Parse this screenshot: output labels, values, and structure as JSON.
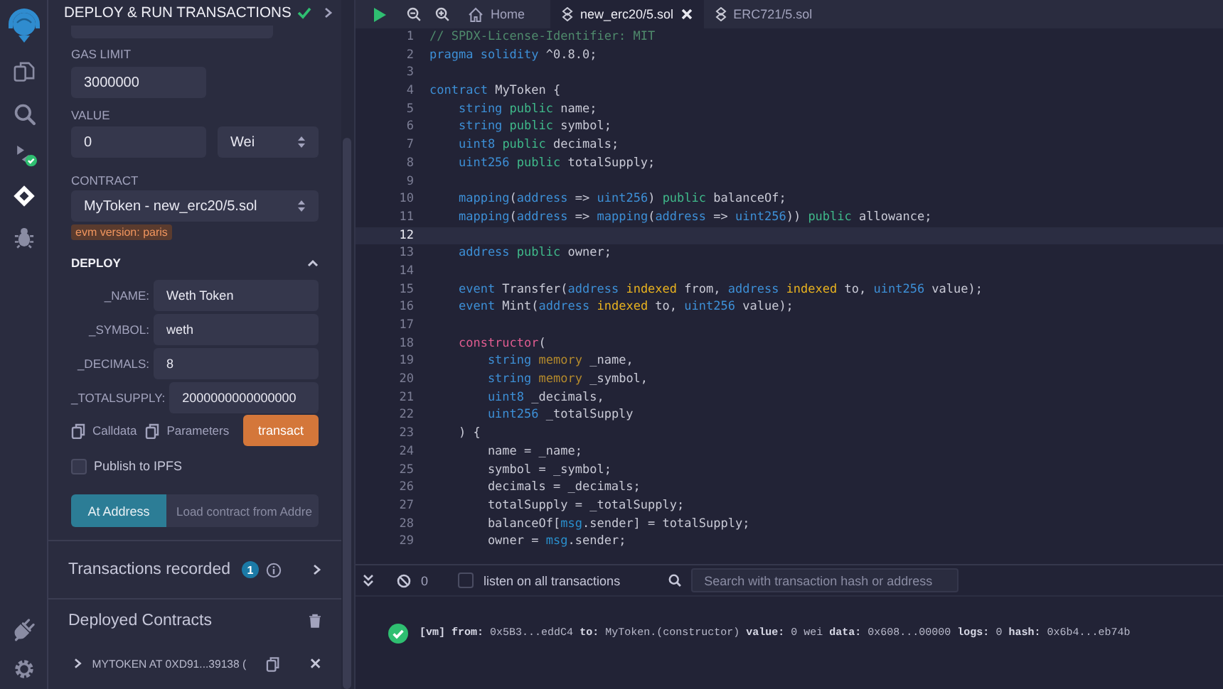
{
  "icon_bar": {
    "items": [
      {
        "kind": "files",
        "selected": false
      },
      {
        "kind": "search",
        "selected": false
      },
      {
        "kind": "compiler",
        "selected": false
      },
      {
        "kind": "deploy",
        "selected": true
      },
      {
        "kind": "debug",
        "selected": false
      }
    ],
    "bottom_items": [
      {
        "kind": "plugins",
        "selected": false
      },
      {
        "kind": "settings",
        "selected": false
      }
    ]
  },
  "side_panel": {
    "title": "DEPLOY & RUN TRANSACTIONS",
    "gas_limit": {
      "label": "GAS LIMIT",
      "value": "3000000"
    },
    "value": {
      "label": "VALUE",
      "amount": "0",
      "unit": "Wei"
    },
    "contract": {
      "label": "CONTRACT",
      "selected_contract": "MyToken - new_erc20/5.sol",
      "badge": "evm version: paris"
    },
    "deploy": {
      "title": "DEPLOY",
      "expanded": true,
      "params": [
        {
          "label": "_NAME:",
          "value": "Weth Token"
        },
        {
          "label": "_SYMBOL:",
          "value": "weth"
        },
        {
          "label": "_DECIMALS:",
          "value": "8"
        },
        {
          "label": "_TOTALSUPPLY:",
          "value": "2000000000000000"
        }
      ],
      "calldata": "Calldata",
      "parameters": "Parameters",
      "transact": "transact"
    },
    "publish_ipfs": {
      "label": "Publish to IPFS",
      "checked": false
    },
    "at_address": {
      "button": "At Address",
      "placeholder": "Load contract from Addre"
    },
    "transactions_recorded": {
      "label": "Transactions recorded",
      "count": "1"
    },
    "deployed_contracts": {
      "title": "Deployed Contracts",
      "items": [
        {
          "label": "MYTOKEN AT 0XD91...39138 (",
          "expanded": false
        }
      ]
    }
  },
  "editor": {
    "tabs": [
      {
        "kind": "home",
        "label": "Home",
        "selected": false
      },
      {
        "kind": "file",
        "label": "new_erc20/5.sol",
        "selected": true
      },
      {
        "kind": "file",
        "label": "ERC721/5.sol",
        "selected": false
      }
    ],
    "lines": [
      {
        "number": "1",
        "current": false,
        "tokens": [
          {
            "kind": "comment",
            "text": "// SPDX-License-Identifier: MIT"
          }
        ]
      },
      {
        "number": "2",
        "current": false,
        "tokens": [
          {
            "kind": "keyword",
            "text": "pragma solidity"
          },
          {
            "kind": "plain",
            "text": " ^0.8.0;"
          }
        ]
      },
      {
        "number": "3",
        "current": false
      },
      {
        "number": "4",
        "current": false,
        "tokens": [
          {
            "kind": "keyword",
            "text": "contract"
          },
          {
            "kind": "plain",
            "text": " MyToken {"
          }
        ]
      },
      {
        "number": "5",
        "current": false,
        "tokens": [
          {
            "kind": "keyword",
            "text": "    string "
          },
          {
            "kind": "modifier",
            "text": "public"
          },
          {
            "kind": "plain",
            "text": " name;"
          }
        ]
      },
      {
        "number": "6",
        "current": false,
        "tokens": [
          {
            "kind": "keyword",
            "text": "    string "
          },
          {
            "kind": "modifier",
            "text": "public"
          },
          {
            "kind": "plain",
            "text": " symbol;"
          }
        ]
      },
      {
        "number": "7",
        "current": false,
        "tokens": [
          {
            "kind": "keyword",
            "text": "    uint8 "
          },
          {
            "kind": "modifier",
            "text": "public"
          },
          {
            "kind": "plain",
            "text": " decimals;"
          }
        ]
      },
      {
        "number": "8",
        "current": false,
        "tokens": [
          {
            "kind": "keyword",
            "text": "    uint256 "
          },
          {
            "kind": "modifier",
            "text": "public"
          },
          {
            "kind": "plain",
            "text": " totalSupply;"
          }
        ]
      },
      {
        "number": "9",
        "current": false
      },
      {
        "number": "10",
        "current": false,
        "tokens": [
          {
            "kind": "keyword",
            "text": "    mapping"
          },
          {
            "kind": "plain",
            "text": "("
          },
          {
            "kind": "keyword",
            "text": "address"
          },
          {
            "kind": "plain",
            "text": " => "
          },
          {
            "kind": "keyword",
            "text": "uint256"
          },
          {
            "kind": "plain",
            "text": ") "
          },
          {
            "kind": "modifier",
            "text": "public"
          },
          {
            "kind": "plain",
            "text": " balanceOf;"
          }
        ]
      },
      {
        "number": "11",
        "current": false,
        "tokens": [
          {
            "kind": "keyword",
            "text": "    mapping"
          },
          {
            "kind": "plain",
            "text": "("
          },
          {
            "kind": "keyword",
            "text": "address"
          },
          {
            "kind": "plain",
            "text": " => "
          },
          {
            "kind": "keyword",
            "text": "mapping"
          },
          {
            "kind": "plain",
            "text": "("
          },
          {
            "kind": "keyword",
            "text": "address"
          },
          {
            "kind": "plain",
            "text": " => "
          },
          {
            "kind": "keyword",
            "text": "uint256"
          },
          {
            "kind": "plain",
            "text": ")) "
          },
          {
            "kind": "modifier",
            "text": "public"
          },
          {
            "kind": "plain",
            "text": " allowance;"
          }
        ]
      },
      {
        "number": "12",
        "current": true
      },
      {
        "number": "13",
        "current": false,
        "tokens": [
          {
            "kind": "keyword",
            "text": "    address "
          },
          {
            "kind": "modifier",
            "text": "public"
          },
          {
            "kind": "plain",
            "text": " owner;"
          }
        ]
      },
      {
        "number": "14",
        "current": false
      },
      {
        "number": "15",
        "current": false,
        "tokens": [
          {
            "kind": "keyword",
            "text": "    event"
          },
          {
            "kind": "plain",
            "text": " Transfer("
          },
          {
            "kind": "keyword",
            "text": "address "
          },
          {
            "kind": "qualifier",
            "text": "indexed"
          },
          {
            "kind": "plain",
            "text": " from, "
          },
          {
            "kind": "keyword",
            "text": "address "
          },
          {
            "kind": "qualifier",
            "text": "indexed"
          },
          {
            "kind": "plain",
            "text": " to, "
          },
          {
            "kind": "keyword",
            "text": "uint256"
          },
          {
            "kind": "plain",
            "text": " value);"
          }
        ]
      },
      {
        "number": "16",
        "current": false,
        "tokens": [
          {
            "kind": "keyword",
            "text": "    event"
          },
          {
            "kind": "plain",
            "text": " Mint("
          },
          {
            "kind": "keyword",
            "text": "address "
          },
          {
            "kind": "qualifier",
            "text": "indexed"
          },
          {
            "kind": "plain",
            "text": " to, "
          },
          {
            "kind": "keyword",
            "text": "uint256"
          },
          {
            "kind": "plain",
            "text": " value);"
          }
        ]
      },
      {
        "number": "17",
        "current": false
      },
      {
        "number": "18",
        "current": false,
        "tokens": [
          {
            "kind": "constructor",
            "text": "    constructor"
          },
          {
            "kind": "plain",
            "text": "("
          }
        ]
      },
      {
        "number": "19",
        "current": false,
        "tokens": [
          {
            "kind": "keyword",
            "text": "        string "
          },
          {
            "kind": "location",
            "text": "memory"
          },
          {
            "kind": "plain",
            "text": " _name,"
          }
        ]
      },
      {
        "number": "20",
        "current": false,
        "tokens": [
          {
            "kind": "keyword",
            "text": "        string "
          },
          {
            "kind": "location",
            "text": "memory"
          },
          {
            "kind": "plain",
            "text": " _symbol,"
          }
        ]
      },
      {
        "number": "21",
        "current": false,
        "tokens": [
          {
            "kind": "keyword",
            "text": "        uint8"
          },
          {
            "kind": "plain",
            "text": " _decimals,"
          }
        ]
      },
      {
        "number": "22",
        "current": false,
        "tokens": [
          {
            "kind": "keyword",
            "text": "        uint256"
          },
          {
            "kind": "plain",
            "text": " _totalSupply"
          }
        ]
      },
      {
        "number": "23",
        "current": false,
        "tokens": [
          {
            "kind": "plain",
            "text": "    ) {"
          }
        ]
      },
      {
        "number": "24",
        "current": false,
        "tokens": [
          {
            "kind": "plain",
            "text": "        name = _name;"
          }
        ]
      },
      {
        "number": "25",
        "current": false,
        "tokens": [
          {
            "kind": "plain",
            "text": "        symbol = _symbol;"
          }
        ]
      },
      {
        "number": "26",
        "current": false,
        "tokens": [
          {
            "kind": "plain",
            "text": "        decimals = _decimals;"
          }
        ]
      },
      {
        "number": "27",
        "current": false,
        "tokens": [
          {
            "kind": "plain",
            "text": "        totalSupply = _totalSupply;"
          }
        ]
      },
      {
        "number": "28",
        "current": false,
        "tokens": [
          {
            "kind": "plain",
            "text": "        balanceOf["
          },
          {
            "kind": "builtin",
            "text": "msg"
          },
          {
            "kind": "plain",
            "text": ".sender] = totalSupply;"
          }
        ]
      },
      {
        "number": "29",
        "current": false,
        "tokens": [
          {
            "kind": "plain",
            "text": "        owner = "
          },
          {
            "kind": "builtin",
            "text": "msg"
          },
          {
            "kind": "plain",
            "text": ".sender;"
          }
        ]
      }
    ]
  },
  "terminal": {
    "pending_count": "0",
    "listen_all": {
      "label": "listen on all transactions",
      "checked": false
    },
    "search_placeholder": "Search with transaction hash or address",
    "log": [
      {
        "success": true,
        "text": "**[vm]** **from:** 0x5B3...eddC4 **to:** MyToken.(constructor) **value:** 0 wei **data:** 0x608...00000 **logs:** 0 **hash:** 0x6b4...eb74b"
      }
    ]
  }
}
